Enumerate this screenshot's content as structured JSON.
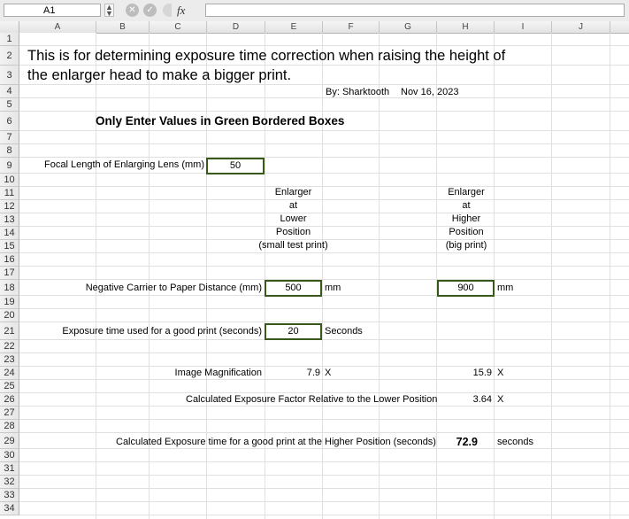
{
  "formula_bar": {
    "cell_ref": "A1",
    "fx": "fx",
    "formula": ""
  },
  "columns": [
    "A",
    "B",
    "C",
    "D",
    "E",
    "F",
    "G",
    "H",
    "I",
    "J"
  ],
  "rows": [
    "1",
    "2",
    "3",
    "4",
    "5",
    "6",
    "7",
    "8",
    "9",
    "10",
    "11",
    "12",
    "13",
    "14",
    "15",
    "16",
    "17",
    "18",
    "19",
    "20",
    "21",
    "22",
    "23",
    "24",
    "25",
    "26",
    "27",
    "28",
    "29",
    "30",
    "31",
    "32",
    "33",
    "34"
  ],
  "sheet": {
    "title_line1": "This is for determining exposure time correction when raising the height of",
    "title_line2": "the enlarger head to make a bigger print.",
    "author": "By: Sharktooth",
    "date": "Nov 16, 2023",
    "instruction": "Only Enter Values in Green Bordered Boxes",
    "focal_label": "Focal Length of Enlarging Lens (mm)",
    "focal_value": "50",
    "lower_header": [
      "Enlarger",
      "at",
      "Lower",
      "Position",
      "(small test print)"
    ],
    "higher_header": [
      "Enlarger",
      "at",
      "Higher",
      "Position",
      "(big print)"
    ],
    "distance_label": "Negative Carrier to Paper Distance (mm)",
    "distance_lower": "500",
    "distance_unit": "mm",
    "distance_higher": "900",
    "exposure_label": "Exposure time used for a good print (seconds)",
    "exposure_value": "20",
    "exposure_unit": "Seconds",
    "magnification_label": "Image Magnification",
    "magnification_lower": "7.9",
    "magnification_higher": "15.9",
    "x_unit": "X",
    "factor_label": "Calculated Exposure Factor Relative to the Lower Position",
    "factor_value": "3.64",
    "result_label": "Calculated Exposure time for a good print at the Higher Position (seconds)",
    "result_value": "72.9",
    "result_unit": "seconds"
  },
  "colors": {
    "input_border": "#39591b",
    "gridline": "#e0e0e0"
  }
}
